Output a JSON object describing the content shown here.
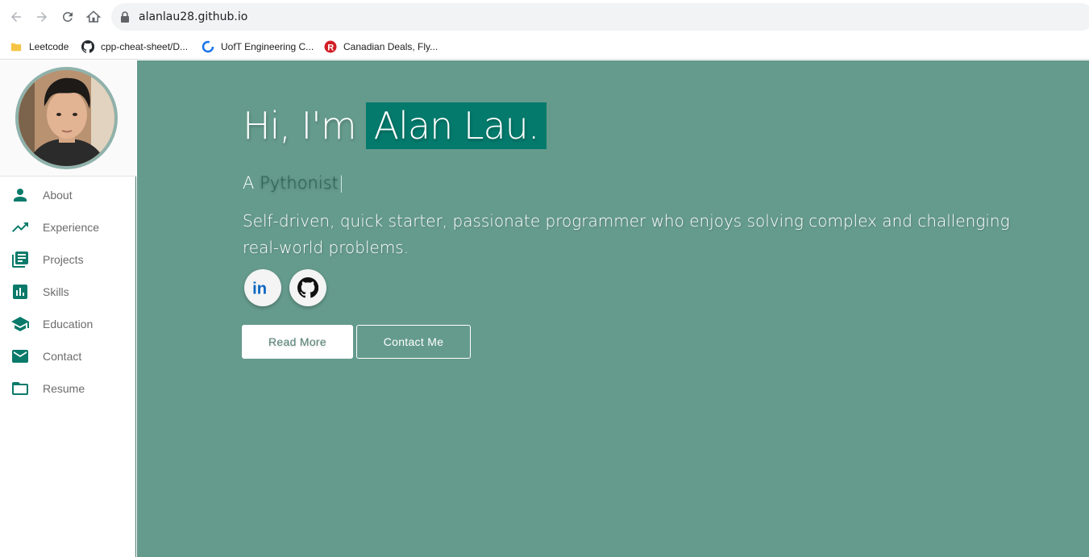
{
  "browser": {
    "url": "alanlau28.github.io",
    "bookmarks": [
      {
        "label": "Leetcode",
        "icon": "folder-icon"
      },
      {
        "label": "cpp-cheat-sheet/D...",
        "icon": "github-icon"
      },
      {
        "label": "UofT Engineering C...",
        "icon": "uoft-icon"
      },
      {
        "label": "Canadian Deals, Fly...",
        "icon": "redflagdeals-icon"
      }
    ]
  },
  "sidebar": {
    "items": [
      {
        "label": "About",
        "icon": "person-icon"
      },
      {
        "label": "Experience",
        "icon": "trending-up-icon"
      },
      {
        "label": "Projects",
        "icon": "library-books-icon"
      },
      {
        "label": "Skills",
        "icon": "bar-chart-icon"
      },
      {
        "label": "Education",
        "icon": "graduation-cap-icon"
      },
      {
        "label": "Contact",
        "icon": "mail-icon"
      },
      {
        "label": "Resume",
        "icon": "folder-icon"
      }
    ]
  },
  "hero": {
    "greeting": "Hi, I'm",
    "name": "Alan Lau.",
    "role_prefix": "A",
    "role": "Pythonist",
    "caret": "|",
    "description": "Self-driven, quick starter, passionate programmer who enjoys solving complex and challenging real-world problems.",
    "social": [
      {
        "name": "LinkedIn",
        "icon": "linkedin-icon"
      },
      {
        "name": "GitHub",
        "icon": "github-icon"
      }
    ],
    "read_more_label": "Read More",
    "contact_label": "Contact Me"
  },
  "colors": {
    "accent": "#037a6c",
    "hero_bg": "#659b8c",
    "icon_teal": "#0a7a6a"
  }
}
